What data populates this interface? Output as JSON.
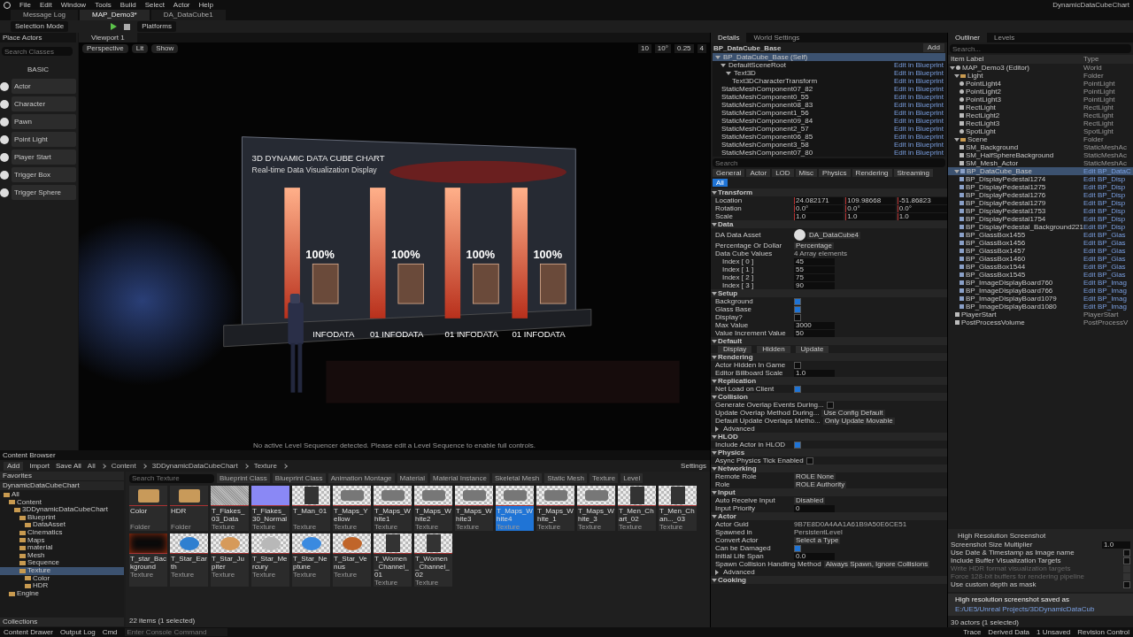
{
  "menu": [
    "File",
    "Edit",
    "Window",
    "Tools",
    "Build",
    "Select",
    "Actor",
    "Help"
  ],
  "project_name": "DynamicDataCubeChart",
  "tabs": [
    {
      "label": "Message Log",
      "selected": false
    },
    {
      "label": "MAP_Demo3*",
      "selected": true
    },
    {
      "label": "DA_DataCube1",
      "selected": false
    }
  ],
  "toolbar": {
    "mode": "Selection Mode",
    "platforms": "Platforms"
  },
  "place_actors": {
    "title": "Place Actors",
    "search_placeholder": "Search Classes",
    "category": "BASIC",
    "items": [
      "Actor",
      "Character",
      "Pawn",
      "Point Light",
      "Player Start",
      "Trigger Box",
      "Trigger Sphere"
    ]
  },
  "viewport": {
    "tab": "Viewport 1",
    "view": "Perspective",
    "lighting": "Lit",
    "show": "Show",
    "snap_values": [
      "10",
      "10°",
      "0.25",
      "4"
    ],
    "scene": {
      "title": "3D DYNAMIC DATA CUBE CHART",
      "subtitle": "Real-time Data Visualization Display",
      "bars": [
        {
          "percent": "100%",
          "label": "INFODATA"
        },
        {
          "percent": "100%",
          "label": "01 INFODATA"
        },
        {
          "percent": "100%",
          "label": "01 INFODATA"
        },
        {
          "percent": "100%",
          "label": "01 INFODATA"
        }
      ]
    },
    "message": "No active Level Sequencer detected. Please edit a Level Sequence to enable full controls."
  },
  "details": {
    "tabs": [
      {
        "label": "Details",
        "selected": true
      },
      {
        "label": "World Settings",
        "selected": false
      }
    ],
    "actor": "BP_DataCube_Base",
    "add": "Add",
    "components": [
      {
        "label": "BP_DataCube_Base (Self)",
        "selected": true,
        "expanded": true,
        "children": [
          {
            "label": "DefaultSceneRoot",
            "selected": false,
            "link": "Edit in Blueprint",
            "expanded": true,
            "children": [
              {
                "label": "Text3D",
                "selected": false,
                "link": "Edit in Blueprint",
                "expanded": true,
                "children": [
                  {
                    "label": "Text3DCharacterTransform",
                    "selected": false,
                    "link": "Edit in Blueprint"
                  }
                ]
              }
            ]
          },
          {
            "label": "StaticMeshComponent07_82",
            "selected": false,
            "link": "Edit in Blueprint"
          },
          {
            "label": "StaticMeshComponent0_55",
            "selected": false,
            "link": "Edit in Blueprint"
          },
          {
            "label": "StaticMeshComponent08_83",
            "selected": false,
            "link": "Edit in Blueprint"
          },
          {
            "label": "StaticMeshComponent1_56",
            "selected": false,
            "link": "Edit in Blueprint"
          },
          {
            "label": "StaticMeshComponent09_84",
            "selected": false,
            "link": "Edit in Blueprint"
          },
          {
            "label": "StaticMeshComponent2_57",
            "selected": false,
            "link": "Edit in Blueprint"
          },
          {
            "label": "StaticMeshComponent06_85",
            "selected": false,
            "link": "Edit in Blueprint"
          },
          {
            "label": "StaticMeshComponent3_58",
            "selected": false,
            "link": "Edit in Blueprint"
          },
          {
            "label": "StaticMeshComponent07_80",
            "selected": false,
            "link": "Edit in Blueprint"
          }
        ]
      }
    ],
    "search_placeholder": "Search",
    "filters": [
      {
        "label": "General",
        "selected": false
      },
      {
        "label": "Actor",
        "selected": false
      },
      {
        "label": "LOD",
        "selected": false
      },
      {
        "label": "Misc",
        "selected": false
      },
      {
        "label": "Physics",
        "selected": false
      },
      {
        "label": "Rendering",
        "selected": false
      },
      {
        "label": "Streaming",
        "selected": false
      },
      {
        "label": "All",
        "selected": true
      }
    ],
    "sections": [
      {
        "title": "Transform",
        "expanded": true,
        "rows": [
          {
            "kind": "vector",
            "label": "Location",
            "values": [
              "24.082171",
              "109.98668",
              "-51.86823"
            ]
          },
          {
            "kind": "vector",
            "label": "Rotation",
            "values": [
              "0.0°",
              "0.0°",
              "0.0°"
            ]
          },
          {
            "kind": "vector",
            "label": "Scale",
            "values": [
              "1.0",
              "1.0",
              "1.0"
            ]
          }
        ]
      },
      {
        "title": "Data",
        "expanded": true,
        "rows": [
          {
            "kind": "asset",
            "label": "DA Data Asset",
            "value": "DA_DataCube4"
          },
          {
            "kind": "dropdown",
            "label": "Percentage Or Dollar",
            "value": "Percentage"
          },
          {
            "kind": "text",
            "label": "Data Cube Values",
            "value": "4 Array elements"
          },
          {
            "kind": "index",
            "label": "Index [ 0 ]",
            "value": "45"
          },
          {
            "kind": "index",
            "label": "Index [ 1 ]",
            "value": "55"
          },
          {
            "kind": "index",
            "label": "Index [ 2 ]",
            "value": "75"
          },
          {
            "kind": "index",
            "label": "Index [ 3 ]",
            "value": "90"
          }
        ]
      },
      {
        "title": "Setup",
        "expanded": true,
        "rows": [
          {
            "kind": "check",
            "label": "Background",
            "checked": true
          },
          {
            "kind": "check",
            "label": "Glass Base",
            "checked": true
          },
          {
            "kind": "check",
            "label": "Display?",
            "checked": false
          },
          {
            "kind": "value",
            "label": "Max Value",
            "value": "3000"
          },
          {
            "kind": "value",
            "label": "Value Increment Value",
            "value": "50"
          }
        ]
      },
      {
        "title": "Default",
        "expanded": true,
        "rows": [
          {
            "kind": "buttons",
            "labels": [
              "Display",
              "Hidden",
              "Update"
            ]
          }
        ]
      },
      {
        "title": "Rendering",
        "expanded": true,
        "rows": [
          {
            "kind": "check",
            "label": "Actor Hidden In Game",
            "checked": false
          },
          {
            "kind": "value",
            "label": "Editor Billboard Scale",
            "value": "1.0"
          }
        ]
      },
      {
        "title": "Replication",
        "expanded": true,
        "rows": [
          {
            "kind": "check",
            "label": "Net Load on Client",
            "checked": true
          }
        ]
      },
      {
        "title": "Collision",
        "expanded": true,
        "rows": [
          {
            "kind": "check",
            "label": "Generate Overlap Events During...",
            "checked": false
          },
          {
            "kind": "dropdown",
            "label": "Update Overlap Method During...",
            "value": "Use Config Default"
          },
          {
            "kind": "dropdown",
            "label": "Default Update Overlaps Metho...",
            "value": "Only Update Movable"
          },
          {
            "kind": "expander",
            "label": "Advanced",
            "expanded": false
          }
        ]
      },
      {
        "title": "HLOD",
        "expanded": true,
        "rows": [
          {
            "kind": "check",
            "label": "Include Actor in HLOD",
            "checked": true
          }
        ]
      },
      {
        "title": "Physics",
        "expanded": true,
        "rows": [
          {
            "kind": "check",
            "label": "Async Physics Tick Enabled",
            "checked": false
          }
        ]
      },
      {
        "title": "Networking",
        "expanded": true,
        "rows": [
          {
            "kind": "dropdown",
            "label": "Remote Role",
            "value": "ROLE None"
          },
          {
            "kind": "dropdown",
            "label": "Role",
            "value": "ROLE Authority"
          }
        ]
      },
      {
        "title": "Input",
        "expanded": true,
        "rows": [
          {
            "kind": "dropdown",
            "label": "Auto Receive Input",
            "value": "Disabled"
          },
          {
            "kind": "value",
            "label": "Input Priority",
            "value": "0"
          }
        ]
      },
      {
        "title": "Actor",
        "expanded": true,
        "rows": [
          {
            "kind": "text",
            "label": "Actor Guid",
            "value": "9B7E8D0A4AA1A61B9A50E6CE51"
          },
          {
            "kind": "text",
            "label": "Spawned in",
            "value": "PersistentLevel"
          },
          {
            "kind": "dropdown",
            "label": "Convert Actor",
            "value": "Select a Type"
          },
          {
            "kind": "check",
            "label": "Can be Damaged",
            "checked": true
          },
          {
            "kind": "value",
            "label": "Initial Life Span",
            "value": "0.0"
          },
          {
            "kind": "dropdown",
            "label": "Spawn Collision Handling Method",
            "value": "Always Spawn, Ignore Collisions"
          },
          {
            "kind": "expander",
            "label": "Advanced",
            "expanded": false
          }
        ]
      },
      {
        "title": "Cooking",
        "expanded": true
      }
    ]
  },
  "outliner": {
    "tabs": [
      {
        "label": "Outliner",
        "selected": true
      },
      {
        "label": "Levels",
        "selected": false
      }
    ],
    "search_placeholder": "Search...",
    "columns": [
      "Item Label",
      "Type"
    ],
    "items": [
      {
        "label": "MAP_Demo3 (Editor)",
        "type": "World",
        "kind": "world",
        "selected": false,
        "expanded": true,
        "children": [
          {
            "label": "Light",
            "type": "Folder",
            "kind": "folder",
            "selected": false,
            "expanded": true,
            "children": [
              {
                "label": "PointLight4",
                "type": "PointLight",
                "kind": "light",
                "selected": false
              },
              {
                "label": "PointLight2",
                "type": "PointLight",
                "kind": "light",
                "selected": false
              },
              {
                "label": "PointLight3",
                "type": "PointLight",
                "kind": "light",
                "selected": false
              },
              {
                "label": "RectLight",
                "type": "RectLight",
                "kind": "rect",
                "selected": false
              },
              {
                "label": "RectLight2",
                "type": "RectLight",
                "kind": "rect",
                "selected": false
              },
              {
                "label": "RectLight3",
                "type": "RectLight",
                "kind": "rect",
                "selected": false
              },
              {
                "label": "SpotLight",
                "type": "SpotLight",
                "kind": "light",
                "selected": false
              }
            ]
          },
          {
            "label": "Scene",
            "type": "Folder",
            "kind": "folder",
            "selected": false,
            "expanded": true,
            "children": [
              {
                "label": "SM_Background",
                "type": "StaticMeshAc",
                "kind": "mesh",
                "selected": false
              },
              {
                "label": "SM_HalfSphereBackground",
                "type": "StaticMeshAc",
                "kind": "mesh",
                "selected": false
              },
              {
                "label": "SM_Mesh_Actor",
                "type": "StaticMeshAc",
                "kind": "mesh",
                "selected": false
              }
            ]
          },
          {
            "label": "BP_DataCube_Base",
            "type": "Edit BP_DataC",
            "kind": "blueprint",
            "link": true,
            "selected": true,
            "expanded": true,
            "children": [
              {
                "label": "BP_DisplayPedestal1274",
                "type": "Edit BP_Disp",
                "kind": "blueprint",
                "link": true,
                "selected": false
              },
              {
                "label": "BP_DisplayPedestal1275",
                "type": "Edit BP_Disp",
                "kind": "blueprint",
                "link": true,
                "selected": false
              },
              {
                "label": "BP_DisplayPedestal1276",
                "type": "Edit BP_Disp",
                "kind": "blueprint",
                "link": true,
                "selected": false
              },
              {
                "label": "BP_DisplayPedestal1279",
                "type": "Edit BP_Disp",
                "kind": "blueprint",
                "link": true,
                "selected": false
              },
              {
                "label": "BP_DisplayPedestal1753",
                "type": "Edit BP_Disp",
                "kind": "blueprint",
                "link": true,
                "selected": false
              },
              {
                "label": "BP_DisplayPedestal1754",
                "type": "Edit BP_Disp",
                "kind": "blueprint",
                "link": true,
                "selected": false
              },
              {
                "label": "BP_DisplayPedestal_Background221",
                "type": "Edit BP_Disp",
                "kind": "blueprint",
                "link": true,
                "selected": false
              },
              {
                "label": "BP_GlassBox1455",
                "type": "Edit BP_Glas",
                "kind": "blueprint",
                "link": true,
                "selected": false
              },
              {
                "label": "BP_GlassBox1456",
                "type": "Edit BP_Glas",
                "kind": "blueprint",
                "link": true,
                "selected": false
              },
              {
                "label": "BP_GlassBox1457",
                "type": "Edit BP_Glas",
                "kind": "blueprint",
                "link": true,
                "selected": false
              },
              {
                "label": "BP_GlassBox1460",
                "type": "Edit BP_Glas",
                "kind": "blueprint",
                "link": true,
                "selected": false
              },
              {
                "label": "BP_GlassBox1544",
                "type": "Edit BP_Glas",
                "kind": "blueprint",
                "link": true,
                "selected": false
              },
              {
                "label": "BP_GlassBox1545",
                "type": "Edit BP_Glas",
                "kind": "blueprint",
                "link": true,
                "selected": false
              },
              {
                "label": "BP_ImageDisplayBoard760",
                "type": "Edit BP_Imag",
                "kind": "blueprint",
                "link": true,
                "selected": false
              },
              {
                "label": "BP_ImageDisplayBoard766",
                "type": "Edit BP_Imag",
                "kind": "blueprint",
                "link": true,
                "selected": false
              },
              {
                "label": "BP_ImageDisplayBoard1079",
                "type": "Edit BP_Imag",
                "kind": "blueprint",
                "link": true,
                "selected": false
              },
              {
                "label": "BP_ImageDisplayBoard1080",
                "type": "Edit BP_Imag",
                "kind": "blueprint",
                "link": true,
                "selected": false
              }
            ]
          },
          {
            "label": "PlayerStart",
            "type": "PlayerStart",
            "kind": "player",
            "selected": false
          },
          {
            "label": "PostProcessVolume",
            "type": "PostProcessV",
            "kind": "volume",
            "selected": false
          }
        ]
      }
    ],
    "footer": "30 actors (1 selected)"
  },
  "screenshot_panel": {
    "title": "High Resolution Screenshot",
    "rows": [
      {
        "kind": "value",
        "label": "Screenshot Size Multiplier",
        "value": "1.0"
      },
      {
        "kind": "check",
        "label": "Use Date & Timestamp as Image name",
        "checked": false,
        "disabled": false
      },
      {
        "kind": "check",
        "label": "Include Buffer Visualization Targets",
        "checked": false,
        "disabled": false
      },
      {
        "kind": "check",
        "label": "Write HDR format visualization targets",
        "checked": false,
        "disabled": true
      },
      {
        "kind": "check",
        "label": "Force 128-bit buffers for rendering pipeline",
        "checked": false,
        "disabled": true
      },
      {
        "kind": "check",
        "label": "Use custom depth as mask",
        "checked": false,
        "disabled": false
      }
    ]
  },
  "notification": {
    "title": "High resolution screenshot saved as",
    "path": "E:/UE5/Unreal Projects/3DDynamicDataCub"
  },
  "content_browser": {
    "title": "Content Browser",
    "add": "Add",
    "import": "Import",
    "save": "Save All",
    "settings": "Settings",
    "path": [
      "All",
      "Content",
      "3DDynamicDataCubeChart",
      "Texture"
    ],
    "favorites": "Favorites",
    "project": "DynamicDataCubeChart",
    "collections": "Collections",
    "folders": [
      {
        "label": "All",
        "selected": false,
        "children": [
          {
            "label": "Content",
            "selected": false,
            "children": [
              {
                "label": "3DDynamicDataCubeChart",
                "selected": false,
                "children": [
                  {
                    "label": "Blueprint",
                    "selected": false,
                    "children": [
                      {
                        "label": "DataAsset",
                        "selected": false
                      }
                    ]
                  },
                  {
                    "label": "Cinematics",
                    "selected": false
                  },
                  {
                    "label": "Maps",
                    "selected": false
                  },
                  {
                    "label": "material",
                    "selected": false
                  },
                  {
                    "label": "Mesh",
                    "selected": false
                  },
                  {
                    "label": "Sequence",
                    "selected": false
                  },
                  {
                    "label": "Texture",
                    "selected": true,
                    "children": [
                      {
                        "label": "Color",
                        "selected": false
                      },
                      {
                        "label": "HDR",
                        "selected": false
                      }
                    ]
                  }
                ]
              }
            ]
          },
          {
            "label": "Engine",
            "selected": false
          }
        ]
      }
    ],
    "search_placeholder": "Search Texture",
    "filters": [
      "Blueprint Class",
      "Blueprint Class",
      "Animation Montage",
      "Material",
      "Material Instance",
      "Skeletal Mesh",
      "Static Mesh",
      "Texture",
      "Level"
    ],
    "assets": [
      {
        "name": "Color",
        "type": "Folder",
        "kind": "folder",
        "selected": false
      },
      {
        "name": "HDR",
        "type": "Folder",
        "kind": "folder",
        "selected": false
      },
      {
        "name": "T_Flakes_03_Data",
        "type": "Texture",
        "kind": "noise",
        "selected": false
      },
      {
        "name": "T_Flakes_30_Normal",
        "type": "Texture",
        "kind": "normal",
        "selected": false
      },
      {
        "name": "T_Man_01",
        "type": "Texture",
        "kind": "photo",
        "selected": false
      },
      {
        "name": "T_Maps_Yellow",
        "type": "Texture",
        "kind": "map",
        "selected": false
      },
      {
        "name": "T_Maps_White1",
        "type": "Texture",
        "kind": "map",
        "selected": false
      },
      {
        "name": "T_Maps_White2",
        "type": "Texture",
        "kind": "map",
        "selected": false
      },
      {
        "name": "T_Maps_White3",
        "type": "Texture",
        "kind": "map",
        "selected": false
      },
      {
        "name": "T_Maps_White4",
        "type": "Texture",
        "kind": "map",
        "selected": true
      },
      {
        "name": "T_Maps_White_1",
        "type": "Texture",
        "kind": "map",
        "selected": false
      },
      {
        "name": "T_Maps_White_3",
        "type": "Texture",
        "kind": "map",
        "selected": false
      },
      {
        "name": "T_Men_Chart_02",
        "type": "Texture",
        "kind": "photo",
        "selected": false
      },
      {
        "name": "T_Men_Chan..._03",
        "type": "Texture",
        "kind": "photo",
        "selected": false
      },
      {
        "name": "T_star_Background",
        "type": "Texture",
        "kind": "space",
        "selected": false
      },
      {
        "name": "T_Star_Earth",
        "type": "Texture",
        "kind": "planet",
        "color": "#2f7fd0",
        "selected": false
      },
      {
        "name": "T_Star_Jupiter",
        "type": "Texture",
        "kind": "planet",
        "color": "#d69a5a",
        "selected": false
      },
      {
        "name": "T_Star_Mercury",
        "type": "Texture",
        "kind": "planet",
        "color": "#b8b8b8",
        "selected": false
      },
      {
        "name": "T_Star_Neptune",
        "type": "Texture",
        "kind": "planet",
        "color": "#3a8ae0",
        "selected": false
      },
      {
        "name": "T_Star_Venus",
        "type": "Texture",
        "kind": "planet",
        "color": "#c0652a",
        "selected": false
      },
      {
        "name": "T_Women_Channel_01",
        "type": "Texture",
        "kind": "photo",
        "selected": false
      },
      {
        "name": "T_Women_Channel_02",
        "type": "Texture",
        "kind": "photo",
        "selected": false
      }
    ],
    "count": "22 items (1 selected)"
  },
  "status_bar": {
    "left": [
      "Content Drawer",
      "Output Log",
      "Cmd"
    ],
    "console_placeholder": "Enter Console Command",
    "right": [
      "Trace",
      "Derived Data",
      "1 Unsaved",
      "Revision Control"
    ]
  }
}
